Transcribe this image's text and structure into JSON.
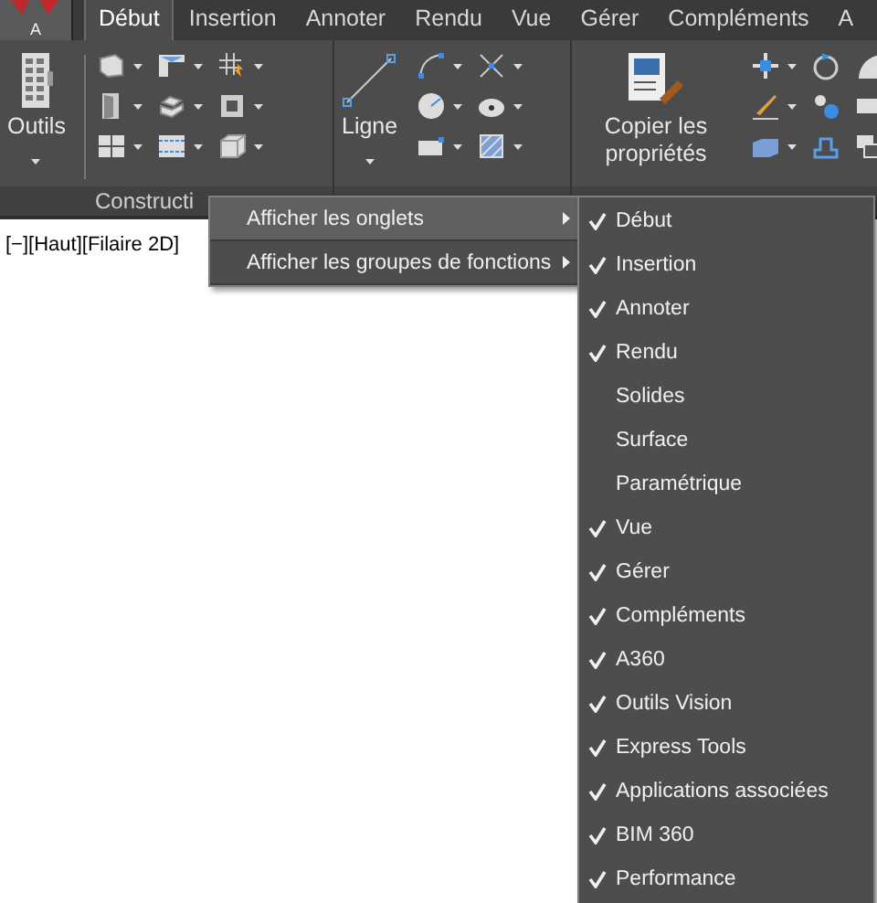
{
  "app_button": {
    "label": "A"
  },
  "tabs": [
    {
      "label": "Début",
      "selected": true
    },
    {
      "label": "Insertion",
      "selected": false
    },
    {
      "label": "Annoter",
      "selected": false
    },
    {
      "label": "Rendu",
      "selected": false
    },
    {
      "label": "Vue",
      "selected": false
    },
    {
      "label": "Gérer",
      "selected": false
    },
    {
      "label": "Compléments",
      "selected": false
    },
    {
      "label": "A",
      "selected": false
    }
  ],
  "ribbon": {
    "panels": [
      {
        "title": "Constructi",
        "large_button": {
          "label": "Outils",
          "caret": true
        }
      },
      {
        "large_button": {
          "label": "Ligne",
          "caret": true
        }
      },
      {
        "large_button": {
          "label": "Copier les propriétés",
          "caret": false
        }
      }
    ]
  },
  "viewport": {
    "label": "[−][Haut][Filaire 2D]"
  },
  "context_menu": {
    "items": [
      {
        "label": "Afficher les onglets",
        "selected": true
      },
      {
        "label": "Afficher les groupes de fonctions",
        "selected": false
      }
    ]
  },
  "submenu": {
    "items": [
      {
        "label": "Début",
        "checked": true
      },
      {
        "label": "Insertion",
        "checked": true
      },
      {
        "label": "Annoter",
        "checked": true
      },
      {
        "label": "Rendu",
        "checked": true
      },
      {
        "label": "Solides",
        "checked": false
      },
      {
        "label": "Surface",
        "checked": false
      },
      {
        "label": "Paramétrique",
        "checked": false
      },
      {
        "label": "Vue",
        "checked": true
      },
      {
        "label": "Gérer",
        "checked": true
      },
      {
        "label": "Compléments",
        "checked": true
      },
      {
        "label": "A360",
        "checked": true
      },
      {
        "label": "Outils Vision",
        "checked": true
      },
      {
        "label": "Express Tools",
        "checked": true
      },
      {
        "label": "Applications associées",
        "checked": true
      },
      {
        "label": "BIM 360",
        "checked": true
      },
      {
        "label": "Performance",
        "checked": true
      }
    ]
  }
}
